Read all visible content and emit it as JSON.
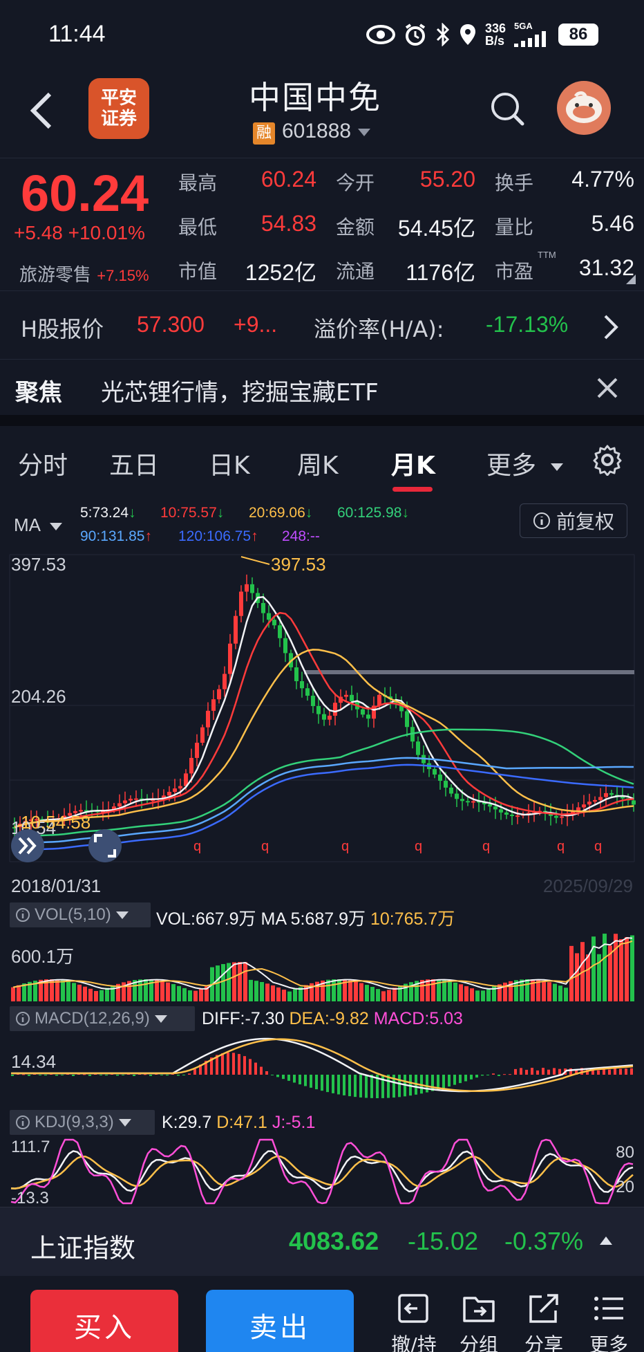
{
  "status": {
    "time": "11:44",
    "net_speed_top": "336",
    "net_speed_bottom": "B/s",
    "network": "5GA",
    "battery": "86"
  },
  "header": {
    "broker_line1": "平安",
    "broker_line2": "证券",
    "stock_name": "中国中免",
    "rong_badge": "融",
    "stock_code": "601888"
  },
  "quote": {
    "price": "60.24",
    "change": "+5.48 +10.01%",
    "sector_name": "旅游零售",
    "sector_change": "+7.15%",
    "fields": [
      {
        "label": "最高",
        "value": "60.24",
        "color": "red"
      },
      {
        "label": "今开",
        "value": "55.20",
        "color": "red"
      },
      {
        "label": "换手",
        "value": "4.77%",
        "color": "white"
      },
      {
        "label": "最低",
        "value": "54.83",
        "color": "red"
      },
      {
        "label": "金额",
        "value": "54.45亿",
        "color": "white"
      },
      {
        "label": "量比",
        "value": "5.46",
        "color": "white"
      },
      {
        "label": "市值",
        "value": "1252亿",
        "color": "white"
      },
      {
        "label": "流通",
        "value": "1176亿",
        "color": "white"
      },
      {
        "label": "市盈",
        "value": "31.32",
        "color": "white",
        "sup": "TTM"
      }
    ]
  },
  "hshare": {
    "label": "H股报价",
    "price": "57.300",
    "change": "+9...",
    "premium_label": "溢价率(H/A):",
    "premium_value": "-17.13%"
  },
  "focus": {
    "label": "聚焦",
    "text": "光芯锂行情，挖掘宝藏ETF"
  },
  "tabs": [
    {
      "label": "分时",
      "active": false
    },
    {
      "label": "五日",
      "active": false
    },
    {
      "label": "日K",
      "active": false
    },
    {
      "label": "周K",
      "active": false
    },
    {
      "label": "月K",
      "active": true
    },
    {
      "label": "更多",
      "active": false
    }
  ],
  "ma": {
    "selector": "MA",
    "fuquan": "前复权",
    "items": [
      {
        "text": "5:73.24",
        "arrow": "↓",
        "color": "#f2f3f6"
      },
      {
        "text": "10:75.57",
        "arrow": "↓",
        "color": "#ff3b3b"
      },
      {
        "text": "20:69.06",
        "arrow": "↓",
        "color": "#ffc04a"
      },
      {
        "text": "60:125.98",
        "arrow": "↓",
        "color": "#33d17a"
      },
      {
        "text": "90:131.85",
        "arrow": "↑",
        "color": "#5aa8ff"
      },
      {
        "text": "120:106.75",
        "arrow": "↑",
        "color": "#3b6bff"
      },
      {
        "text": "248:--",
        "arrow": "",
        "color": "#c04dff"
      }
    ]
  },
  "kline": {
    "y_max_label": "397.53",
    "y_mid_label": "204.26",
    "y_low_label": "10.54",
    "low_marker": "10.54.58",
    "high_marker": "397.53",
    "start_date": "2018/01/31",
    "end_date": "2025/09/29",
    "q_marker": "q",
    "colors": {
      "up": "#ff3b3b",
      "down": "#23c24c"
    }
  },
  "vol": {
    "label": "VOL(5,10)",
    "vol": "VOL:667.9万",
    "ma5": "MA 5:687.9万",
    "ma10": "10:765.7万",
    "y_label": "600.1万"
  },
  "macd": {
    "label": "MACD(12,26,9)",
    "diff": "DIFF:-7.30",
    "dea": "DEA:-9.82",
    "macd": "MACD:5.03",
    "y_label": "14.34"
  },
  "kdj": {
    "label": "KDJ(9,3,3)",
    "k": "K:29.7",
    "d": "D:47.1",
    "j": "J:-5.1",
    "y_top": "111.7",
    "y_bottom": "-13.3",
    "r_top": "80",
    "r_bottom": "20"
  },
  "index": {
    "name": "上证指数",
    "value": "4083.62",
    "change": "-15.02",
    "pct": "-0.37%"
  },
  "actions": {
    "buy": "买入",
    "sell": "卖出",
    "tools": [
      "撤/持",
      "分组",
      "分享",
      "更多"
    ]
  }
}
